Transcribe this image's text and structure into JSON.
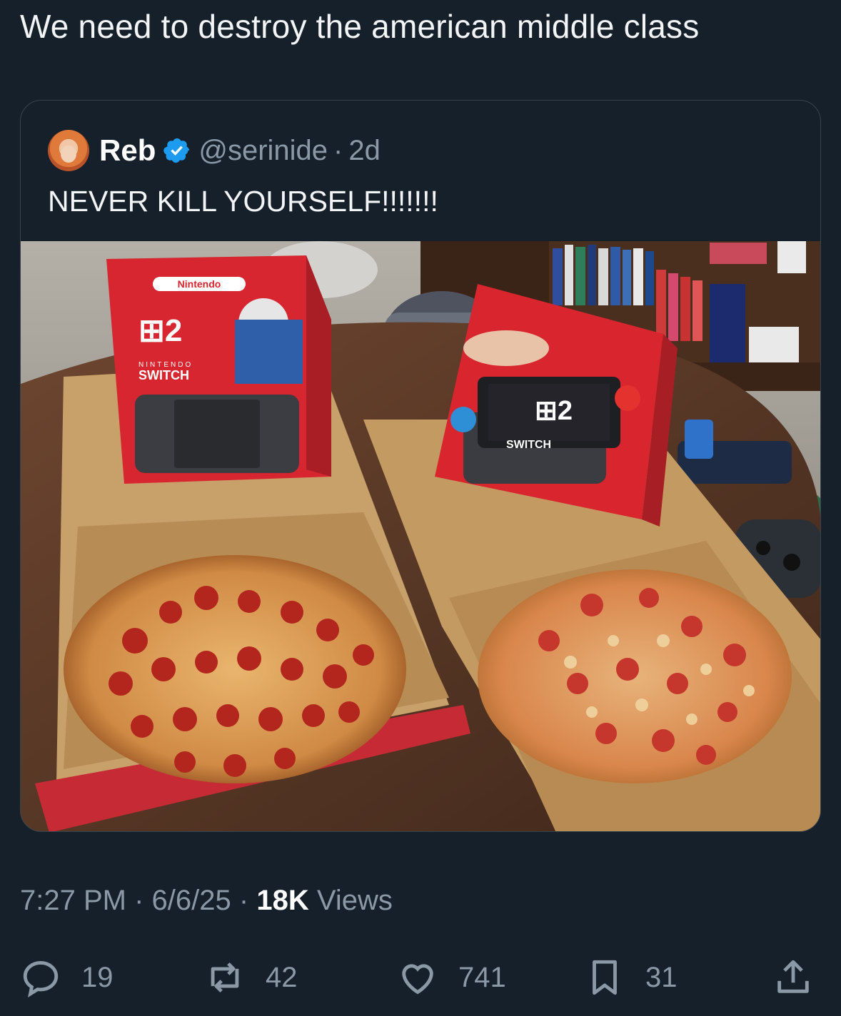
{
  "tweet": {
    "text": "We need to destroy the american middle class"
  },
  "quote": {
    "name": "Reb",
    "handle": "@serinide",
    "separator": "·",
    "time_ago": "2d",
    "text": "NEVER KILL YOURSELF!!!!!!!"
  },
  "photo": {
    "box_brand": "Nintendo",
    "box_logo": "2",
    "box_line1": "NINTENDO",
    "box_line2": "SWITCH"
  },
  "meta": {
    "time": "7:27 PM",
    "date": "6/6/25",
    "views_count": "18K",
    "views_label": "Views",
    "separator": "·"
  },
  "actions": {
    "replies": "19",
    "reposts": "42",
    "likes": "741",
    "bookmarks": "31"
  },
  "colors": {
    "background": "#15202b",
    "muted_text": "#8b98a5",
    "verified": "#1d9bf0",
    "border": "#38444d"
  }
}
